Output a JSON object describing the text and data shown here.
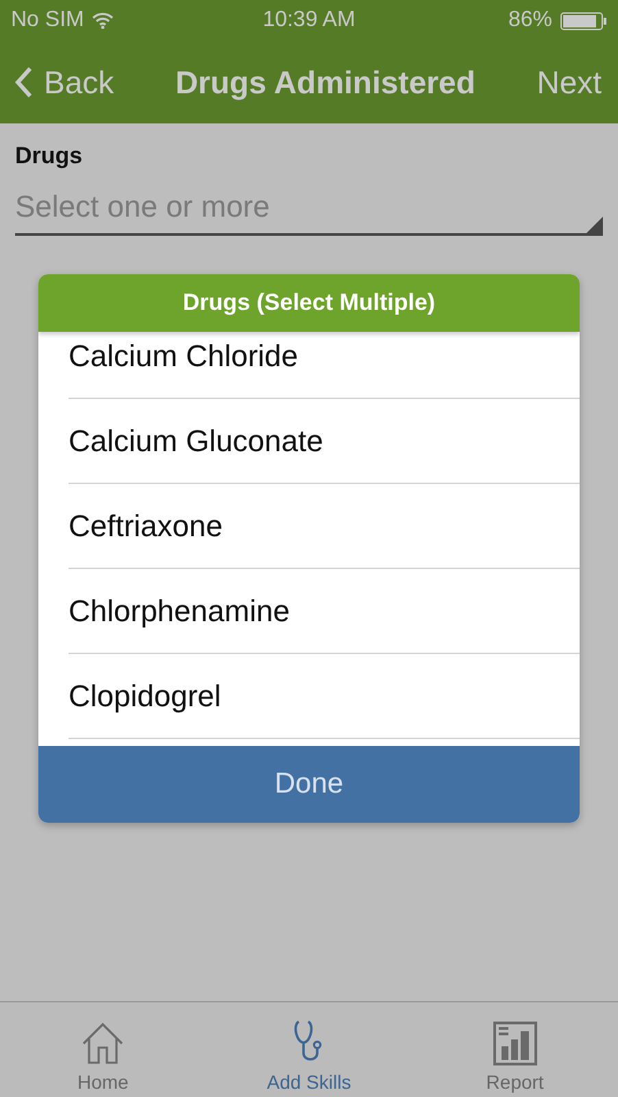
{
  "status_bar": {
    "carrier": "No SIM",
    "time": "10:39 AM",
    "battery": "86%"
  },
  "nav_bar": {
    "back": "Back",
    "title": "Drugs Administered",
    "next": "Next"
  },
  "field": {
    "label": "Drugs",
    "placeholder": "Select one or more"
  },
  "dialog": {
    "title": "Drugs (Select Multiple)",
    "items": [
      {
        "label": "Calcium Chloride",
        "selected": false
      },
      {
        "label": "Calcium Gluconate",
        "selected": false
      },
      {
        "label": "Ceftriaxone",
        "selected": false
      },
      {
        "label": "Chlorphenamine",
        "selected": false
      },
      {
        "label": "Clopidogrel",
        "selected": false
      }
    ],
    "done": "Done"
  },
  "tabs": [
    {
      "label": "Home",
      "kind": "home",
      "selected": false
    },
    {
      "label": "Add Skills",
      "kind": "stethoscope",
      "selected": true
    },
    {
      "label": "Report",
      "kind": "report",
      "selected": false
    }
  ]
}
